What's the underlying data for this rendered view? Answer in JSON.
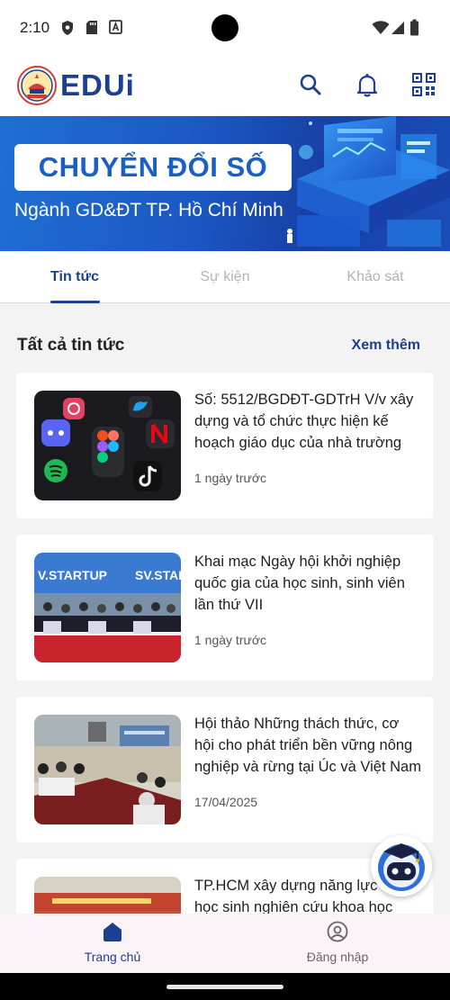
{
  "status_bar": {
    "time": "2:10",
    "icons": [
      "shield-icon",
      "sd-card-icon",
      "text-a-icon",
      "wifi-icon",
      "signal-icon",
      "battery-icon"
    ]
  },
  "header": {
    "brand": "EDUi",
    "brand_color": "#1c3f94",
    "icons": [
      "search-icon",
      "bell-icon",
      "qr-code-icon"
    ]
  },
  "banner": {
    "title": "CHUYỂN ĐỔI SỐ",
    "subtitle": "Ngành GD&ĐT TP. Hồ Chí Minh"
  },
  "tabs": [
    {
      "label": "Tin tức",
      "active": true
    },
    {
      "label": "Sự kiện",
      "active": false
    },
    {
      "label": "Khảo sát",
      "active": false
    }
  ],
  "section": {
    "title": "Tất cả tin tức",
    "see_more": "Xem thêm"
  },
  "news": [
    {
      "title": "Số: 5512/BGDĐT-GDTrH V/v xây dựng và tổ chức thực hiện kế hoạch giáo dục của nhà trường",
      "date": "1 ngày trước"
    },
    {
      "title": "Khai mạc Ngày hội khởi nghiệp quốc gia của học sinh, sinh viên lần thứ VII",
      "date": "1 ngày trước"
    },
    {
      "title": "Hội thảo Những thách thức, cơ hội cho phát triển bền vững nông nghiệp và rừng tại Úc và Việt Nam",
      "date": "17/04/2025"
    },
    {
      "title": "TP.HCM xây dựng năng lực cho học sinh nghiên cứu khoa học",
      "date": ""
    }
  ],
  "thumb_texts": {
    "startup": "V.STARTUP",
    "startup2": "SV.STAR"
  },
  "bottom_nav": [
    {
      "label": "Trang chủ",
      "icon": "home-icon",
      "active": true
    },
    {
      "label": "Đăng nhập",
      "icon": "user-icon",
      "active": false
    }
  ],
  "colors": {
    "accent": "#1c3f94",
    "banner": "#1b57c2",
    "nav_bg": "#fbf3f8"
  }
}
